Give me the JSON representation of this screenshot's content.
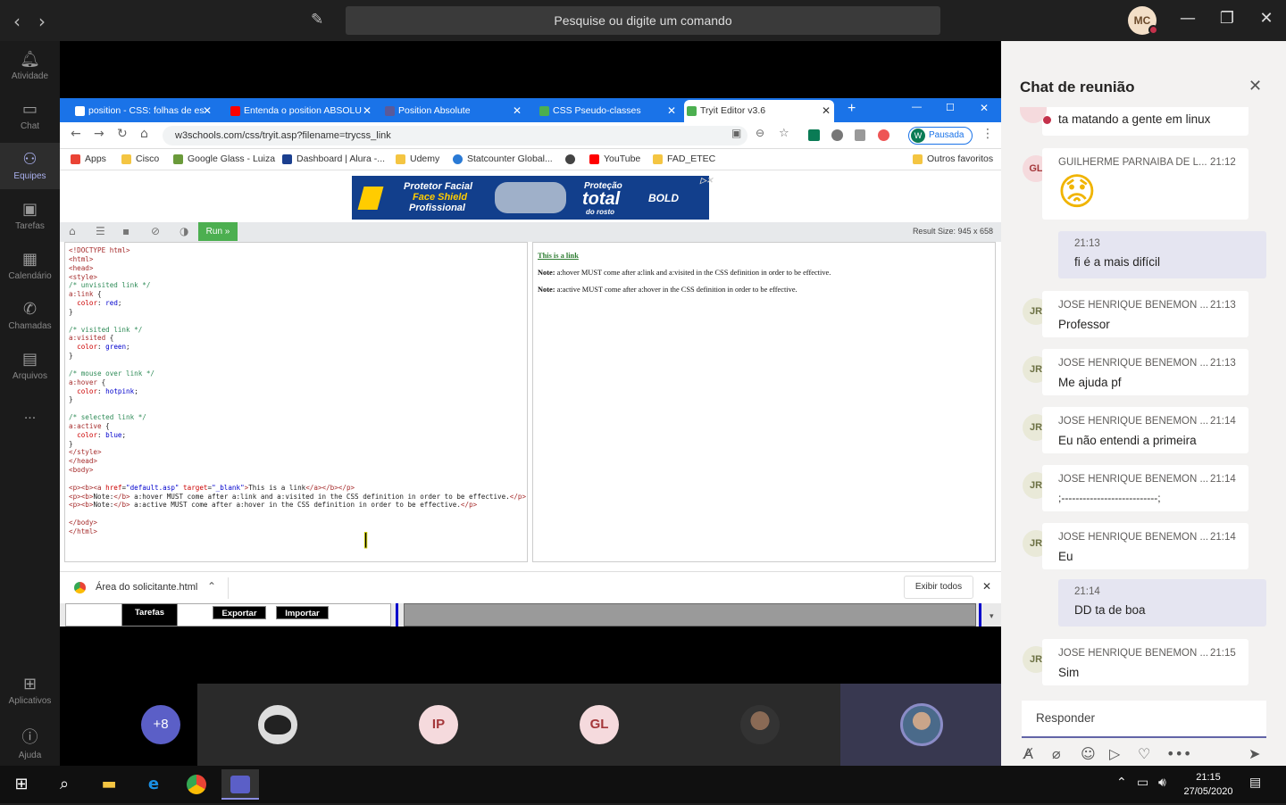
{
  "topbar": {
    "search_placeholder": "Pesquise ou digite um comando",
    "user_initials": "MC"
  },
  "rail": [
    {
      "label": "Atividade",
      "icon": "bell-icon"
    },
    {
      "label": "Chat",
      "icon": "chat-icon"
    },
    {
      "label": "Equipes",
      "icon": "teams-icon"
    },
    {
      "label": "Tarefas",
      "icon": "tasks-icon"
    },
    {
      "label": "Calendário",
      "icon": "calendar-icon"
    },
    {
      "label": "Chamadas",
      "icon": "phone-icon"
    },
    {
      "label": "Arquivos",
      "icon": "files-icon"
    },
    {
      "label": "...",
      "icon": "more-icon"
    },
    {
      "label": "Aplicativos",
      "icon": "apps-icon"
    },
    {
      "label": "Ajuda",
      "icon": "help-icon"
    }
  ],
  "browser": {
    "tabs": [
      "position - CSS: folhas de es",
      "Entenda o position ABSOLU",
      "Position Absolute",
      "CSS Pseudo-classes",
      "Tryit Editor v3.6"
    ],
    "url": "w3schools.com/css/tryit.asp?filename=trycss_link",
    "profile_status": "Pausada",
    "profile_initial": "W",
    "bookmarks": [
      "Apps",
      "Cisco",
      "Google Glass - Luiza",
      "Dashboard | Alura -...",
      "Udemy",
      "Statcounter Global...",
      "",
      "YouTube",
      "FAD_ETEC"
    ],
    "other_favorites": "Outros favoritos",
    "ad": {
      "line1": "Protetor Facial",
      "line2": "Face Shield",
      "line3": "Profissional",
      "line4": "Proteção",
      "line5": "total",
      "line6": "do rosto",
      "brand": "BOLD"
    },
    "run_label": "Run »",
    "result_size": "Result Size: 945 x 658",
    "result": {
      "link": "This is a link",
      "note1_b": "Note:",
      "note1": " a:hover MUST come after a:link and a:visited in the CSS definition in order to be effective.",
      "note2_b": "Note:",
      "note2": " a:active MUST come after a:hover in the CSS definition in order to be effective."
    },
    "download": {
      "file": "Área do solicitante.html",
      "show_all": "Exibir todos"
    },
    "page_buttons": [
      "Tarefas",
      "Exportar",
      "Importar"
    ]
  },
  "participants": {
    "overflow": "+8",
    "initials": [
      "IP",
      "GL"
    ]
  },
  "chat": {
    "title": "Chat de reunião",
    "messages": [
      {
        "type": "other",
        "text": "ta matando a gente em linux"
      },
      {
        "type": "other",
        "initials": "GL",
        "name": "GUILHERME PARNAIBA DE L...",
        "time": "21:12",
        "emoji": "😟"
      },
      {
        "type": "mine",
        "time": "21:13",
        "text": "fi é a mais difícil"
      },
      {
        "type": "other",
        "initials": "JR",
        "name": "JOSE HENRIQUE BENEMON ...",
        "time": "21:13",
        "text": "Professor"
      },
      {
        "type": "other",
        "initials": "JR",
        "name": "JOSE HENRIQUE BENEMON ...",
        "time": "21:13",
        "text": "Me ajuda pf"
      },
      {
        "type": "other",
        "initials": "JR",
        "name": "JOSE HENRIQUE BENEMON ...",
        "time": "21:14",
        "text": "Eu não entendi a primeira"
      },
      {
        "type": "other",
        "initials": "JR",
        "name": "JOSE HENRIQUE BENEMON ...",
        "time": "21:14",
        "text": ";---------------------------;"
      },
      {
        "type": "other",
        "initials": "JR",
        "name": "JOSE HENRIQUE BENEMON ...",
        "time": "21:14",
        "text": "Eu"
      },
      {
        "type": "mine",
        "time": "21:14",
        "text": "DD ta de boa"
      },
      {
        "type": "other",
        "initials": "JR",
        "name": "JOSE HENRIQUE BENEMON ...",
        "time": "21:15",
        "text": "Sim"
      }
    ],
    "reply_placeholder": "Responder"
  },
  "taskbar": {
    "time": "21:15",
    "date": "27/05/2020"
  },
  "colors": {
    "teams_accent": "#6264a7",
    "chrome_blue": "#1a73e8",
    "run_green": "#4caf50",
    "presence_busy": "#c4314b"
  }
}
